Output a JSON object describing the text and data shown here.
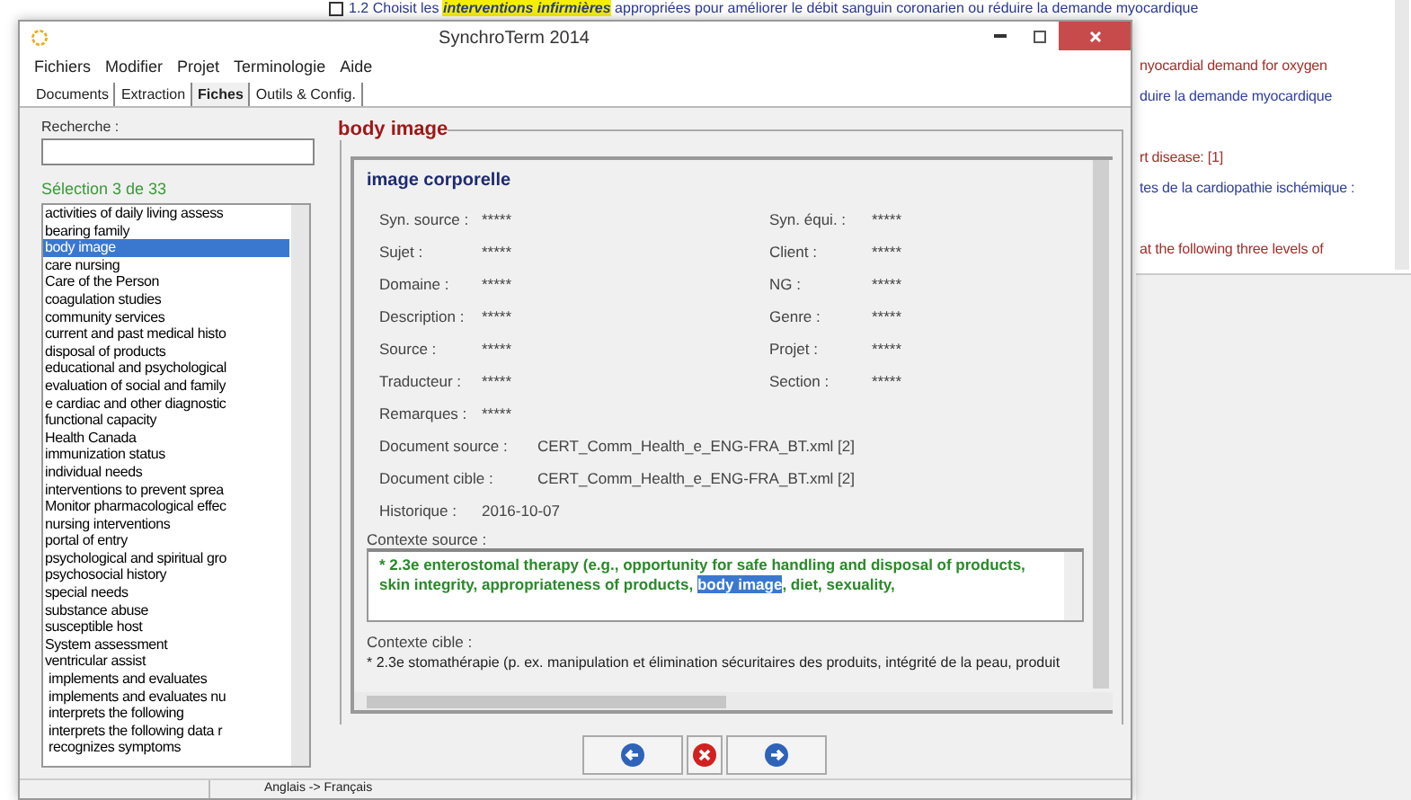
{
  "background_document": {
    "top_line": "1.2 Choisit les **interventions infirmières** appropriées pour améliorer le débit sanguin coronarien ou réduire la demande myocardique",
    "lines": [
      {
        "text": "nyocardial demand for oxygen",
        "kind": "english"
      },
      {
        "text": "duire la demande myocardique",
        "kind": "french"
      },
      {
        "text": "rt disease: [1]",
        "kind": "english"
      },
      {
        "text": "tes de la cardiopathie ischémique :",
        "kind": "french"
      },
      {
        "text": "at the following three levels of",
        "kind": "english"
      }
    ]
  },
  "window": {
    "title": "SynchroTerm 2014"
  },
  "menu": [
    "Fichiers",
    "Modifier",
    "Projet",
    "Terminologie",
    "Aide"
  ],
  "tabs": [
    {
      "label": "Documents",
      "selected": false
    },
    {
      "label": "Extraction",
      "selected": false
    },
    {
      "label": "Fiches",
      "selected": true
    },
    {
      "label": "Outils & Config.",
      "selected": false
    }
  ],
  "search": {
    "label": "Recherche :"
  },
  "selection_count": "Sélection 3 de 33",
  "term_list": [
    {
      "label": "activities of daily living assess",
      "selected": false
    },
    {
      "label": "bearing family",
      "selected": false
    },
    {
      "label": "body image",
      "selected": true
    },
    {
      "label": "care nursing",
      "selected": false
    },
    {
      "label": "Care of the Person",
      "selected": false
    },
    {
      "label": "coagulation studies",
      "selected": false
    },
    {
      "label": "community services",
      "selected": false
    },
    {
      "label": "current and past medical histo",
      "selected": false
    },
    {
      "label": "disposal of products",
      "selected": false
    },
    {
      "label": "educational and psychological",
      "selected": false
    },
    {
      "label": "evaluation of social and family",
      "selected": false
    },
    {
      "label": "e cardiac and other diagnostic",
      "selected": false
    },
    {
      "label": "functional capacity",
      "selected": false
    },
    {
      "label": "Health Canada",
      "selected": false
    },
    {
      "label": "immunization status",
      "selected": false
    },
    {
      "label": "individual needs",
      "selected": false
    },
    {
      "label": "interventions to prevent sprea",
      "selected": false
    },
    {
      "label": "Monitor pharmacological effec",
      "selected": false
    },
    {
      "label": "nursing interventions",
      "selected": false
    },
    {
      "label": "portal of entry",
      "selected": false
    },
    {
      "label": "psychological and spiritual gro",
      "selected": false
    },
    {
      "label": "psychosocial history",
      "selected": false
    },
    {
      "label": "special needs",
      "selected": false
    },
    {
      "label": "substance abuse",
      "selected": false
    },
    {
      "label": "susceptible host",
      "selected": false
    },
    {
      "label": "System assessment",
      "selected": false
    },
    {
      "label": "ventricular assist",
      "selected": false
    },
    {
      "label": " implements and evaluates",
      "selected": false
    },
    {
      "label": " implements and evaluates nu",
      "selected": false
    },
    {
      "label": " interprets the following",
      "selected": false
    },
    {
      "label": " interprets the following data r",
      "selected": false
    },
    {
      "label": " recognizes symptoms",
      "selected": false
    }
  ],
  "record": {
    "heading": "body image",
    "term": "image corporelle",
    "fields": [
      {
        "label": "Syn. source :",
        "value": "*****"
      },
      {
        "label": "Syn. équi. :",
        "value": "*****"
      },
      {
        "label": "Sujet :",
        "value": "*****"
      },
      {
        "label": "Client :",
        "value": "*****"
      },
      {
        "label": "Domaine :",
        "value": "*****"
      },
      {
        "label": "NG :",
        "value": "*****"
      },
      {
        "label": "Description :",
        "value": "*****"
      },
      {
        "label": "Genre :",
        "value": "*****"
      },
      {
        "label": "Source :",
        "value": "*****"
      },
      {
        "label": "Projet :",
        "value": "*****"
      },
      {
        "label": "Traducteur :",
        "value": "*****"
      },
      {
        "label": "Section :",
        "value": "*****"
      }
    ],
    "remarks": {
      "label": "Remarques :",
      "value": "*****"
    },
    "documents": [
      {
        "label": "Document source :",
        "value": "CERT_Comm_Health_e_ENG-FRA_BT.xml [2]"
      },
      {
        "label": "Document cible :",
        "value": "CERT_Comm_Health_e_ENG-FRA_BT.xml [2]"
      }
    ],
    "history": {
      "label": "Historique :",
      "value": "2016-10-07"
    },
    "source_context": {
      "label": "Contexte source :",
      "before": " * 2.3e enterostomal therapy (e.g., opportunity for safe handling and disposal of products, skin integrity, appropriateness of products, ",
      "highlight": "body image",
      "after": ", diet, sexuality,"
    },
    "target_context": {
      "label": "Contexte cible :",
      "text": " * 2.3e stomathérapie (p. ex. manipulation et élimination sécuritaires des produits, intégrité de la peau, produit"
    }
  },
  "status_bar": {
    "language_pair": "Anglais -> Français"
  }
}
